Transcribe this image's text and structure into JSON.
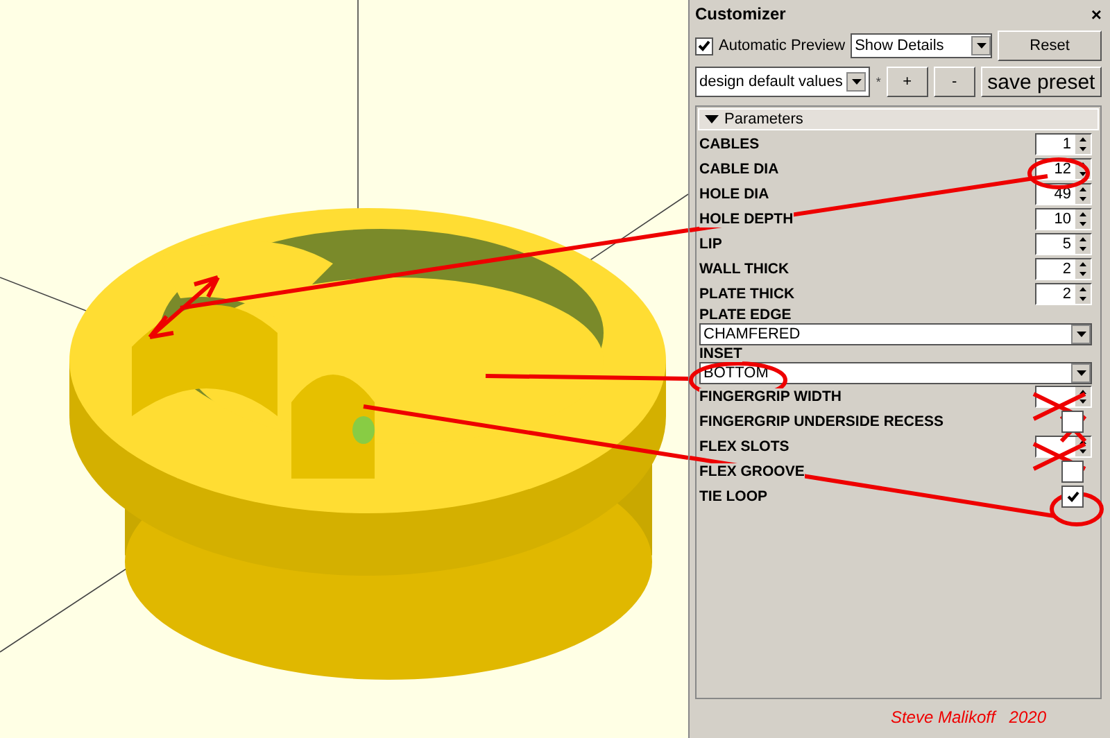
{
  "customizer": {
    "title": "Customizer",
    "close": "×",
    "automatic_preview": {
      "label": "Automatic Preview",
      "checked": true
    },
    "detail_select": {
      "value": "Show Details"
    },
    "reset_button": "Reset",
    "preset_select": {
      "value": "design default values"
    },
    "modified_mark": "*",
    "buttons": [
      "+",
      "-",
      "save preset"
    ],
    "section": {
      "title": "Parameters",
      "expanded": true
    },
    "parameters": [
      {
        "kind": "spin",
        "label": "CABLES",
        "value": "1"
      },
      {
        "kind": "spin",
        "label": "CABLE DIA",
        "value": "12"
      },
      {
        "kind": "spin",
        "label": "HOLE DIA",
        "value": "49"
      },
      {
        "kind": "spin",
        "label": "HOLE DEPTH",
        "value": "10"
      },
      {
        "kind": "spin",
        "label": "LIP",
        "value": "5"
      },
      {
        "kind": "spin",
        "label": "WALL THICK",
        "value": "2"
      },
      {
        "kind": "spin",
        "label": "PLATE THICK",
        "value": "2"
      },
      {
        "kind": "dropdown",
        "label": "PLATE EDGE",
        "value": "CHAMFERED"
      },
      {
        "kind": "dropdown",
        "label": "INSET",
        "value": "BOTTOM"
      },
      {
        "kind": "spin",
        "label": "FINGERGRIP WIDTH"
      },
      {
        "kind": "checkbox",
        "label": "FINGERGRIP UNDERSIDE RECESS",
        "checked": false
      },
      {
        "kind": "spin",
        "label": "FLEX SLOTS"
      },
      {
        "kind": "checkbox",
        "label": "FLEX GROOVE",
        "checked": false
      },
      {
        "kind": "checkbox",
        "label": "TIE LOOP",
        "checked": true
      }
    ]
  },
  "credit": "Steve Malikoff   2020"
}
